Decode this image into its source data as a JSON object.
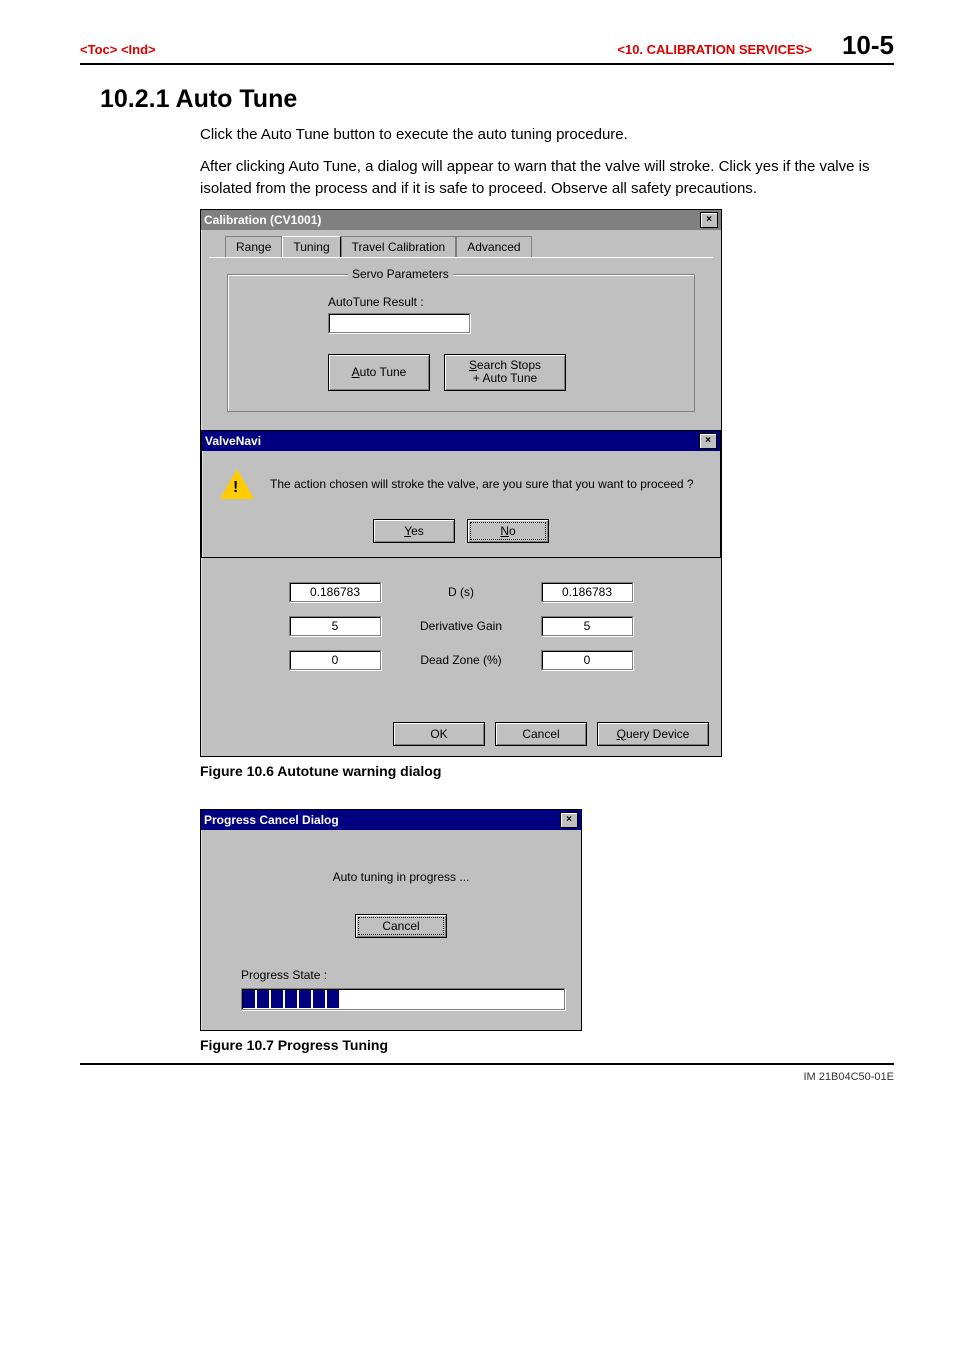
{
  "header": {
    "left_toc": "<Toc>",
    "left_ind": "<Ind>",
    "section": "<10.  CALIBRATION SERVICES>",
    "page": "10-5"
  },
  "heading": "10.2.1  Auto Tune",
  "para1": "Click the Auto Tune button to execute the auto tuning procedure.",
  "para2": "After clicking Auto Tune, a dialog will appear to warn that the valve will stroke.  Click yes if the valve is isolated from the process and if it is safe to proceed.  Observe all safety precautions.",
  "calib_dialog": {
    "title": "Calibration (CV1001)",
    "tabs": {
      "range": "Range",
      "tuning": "Tuning",
      "travel": "Travel Calibration",
      "advanced": "Advanced"
    },
    "group_label": "Servo Parameters",
    "autotune_result_label": "AutoTune Result :",
    "autotune_btn": "Auto Tune",
    "search_btn_line1": "Search Stops",
    "search_btn_line2": "+ Auto Tune",
    "params": {
      "d_label": "D (s)",
      "d_left": "0.186783",
      "d_right": "0.186783",
      "dg_label": "Derivative Gain",
      "dg_left": "5",
      "dg_right": "5",
      "dz_label": "Dead Zone (%)",
      "dz_left": "0",
      "dz_right": "0"
    },
    "ok": "OK",
    "cancel": "Cancel",
    "query": "Query Device"
  },
  "warn_dialog": {
    "title": "ValveNavi",
    "message": "The action chosen will stroke the valve, are you sure that you want to proceed ?",
    "yes": "Yes",
    "no": "No"
  },
  "fig1_caption": "Figure 10.6 Autotune warning dialog",
  "progress_dialog": {
    "title": "Progress Cancel Dialog",
    "message": "Auto tuning in progress ...",
    "cancel": "Cancel",
    "state_label": "Progress State :"
  },
  "fig2_caption": "Figure 10.7 Progress Tuning",
  "footer": "IM 21B04C50-01E"
}
